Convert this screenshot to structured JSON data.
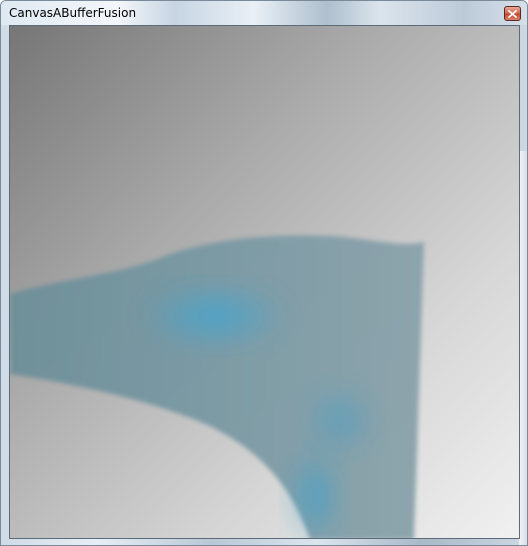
{
  "window": {
    "title": "CanvasABufferFusion"
  },
  "icons": {
    "close": "close-icon"
  },
  "colors": {
    "frame": "#7a8a99",
    "close_button": "#c34a30",
    "background_dark": "#7a7a7a",
    "background_light": "#f0f0f0",
    "fluid": "#7ea6b3",
    "fluid_highlight": "#3ea3cc"
  }
}
